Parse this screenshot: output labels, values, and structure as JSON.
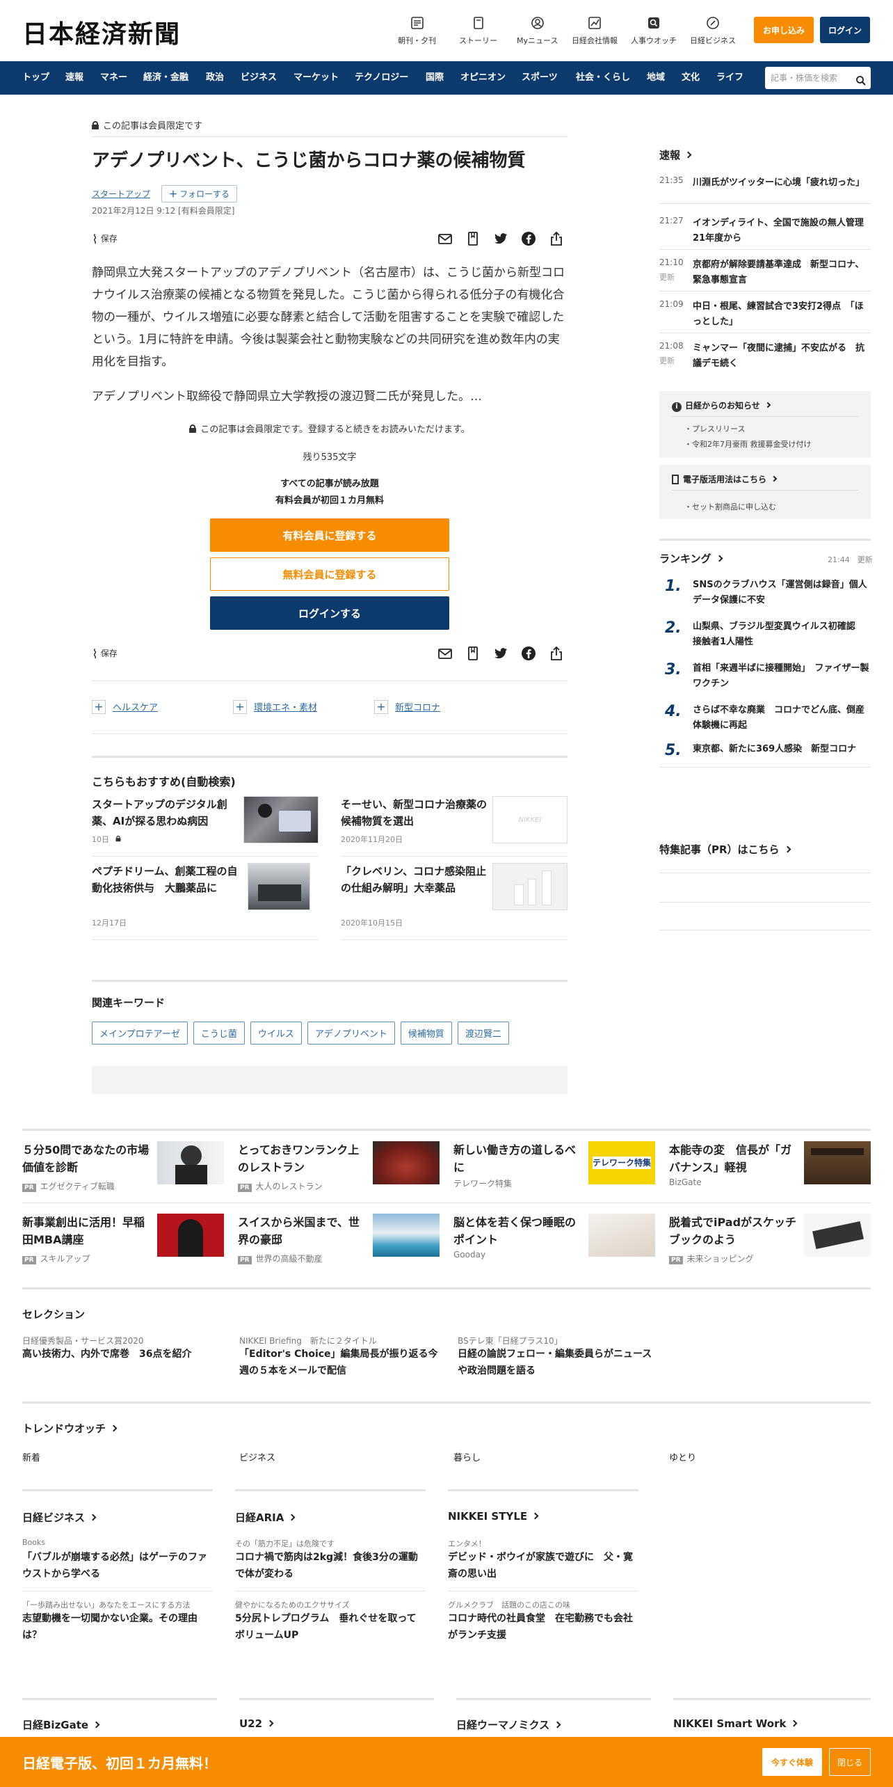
{
  "header": {
    "logo": "日本経済新聞",
    "nav": [
      {
        "label": "朝刊・夕刊",
        "icon": "newspaper-icon"
      },
      {
        "label": "ストーリー",
        "icon": "story-icon"
      },
      {
        "label": "Myニュース",
        "icon": "user-icon"
      },
      {
        "label": "日経会社情報",
        "icon": "chart-icon"
      },
      {
        "label": "人事ウオッチ",
        "icon": "search-icon"
      },
      {
        "label": "日経ビジネス",
        "icon": "compass-icon"
      }
    ],
    "apply": "お申し込み",
    "login": "ログイン"
  },
  "navbar": {
    "items": [
      "トップ",
      "速報",
      "マネー",
      "経済・金融",
      "政治",
      "ビジネス",
      "マーケット",
      "テクノロジー",
      "国際",
      "オピニオン",
      "スポーツ",
      "社会・くらし",
      "地域",
      "文化",
      "ライフ"
    ],
    "search_placeholder": "記事・株価を検索"
  },
  "article": {
    "members_only": "この記事は会員限定です",
    "title": "アデノプリベント、こうじ菌からコロナ薬の候補物質",
    "tag": "スタートアップ",
    "follow": "フォローする",
    "date": "2021年2月12日 9:12 [有料会員限定]",
    "save": "保存",
    "p1": "静岡県立大発スタートアップのアデノプリベント（名古屋市）は、こうじ菌から新型コロナウイルス治療薬の候補となる物質を発見した。こうじ菌から得られる低分子の有機化合物の一種が、ウイルス増殖に必要な酵素と結合して活動を阻害することを実験で確認したという。1月に特許を申請。今後は製薬会社と動物実験などの共同研究を進め数年内の実用化を目指す。",
    "p2": "アデノプリベント取締役で静岡県立大学教授の渡辺賢二氏が発見した。…",
    "paywall_note": "この記事は会員限定です。登録すると続きをお読みいただけます。",
    "remaining": "残り535文字",
    "offer1": "すべての記事が読み放題",
    "offer2": "有料会員が初回１カ月無料",
    "btn_paid": "有料会員に登録する",
    "btn_free": "無料会員に登録する",
    "btn_login": "ログインする",
    "topics": [
      "ヘルスケア",
      "環境エネ・素材",
      "新型コロナ"
    ],
    "rec_title": "こちらもおすすめ(自動検索)",
    "recs": [
      {
        "title": "スタートアップのデジタル創薬、AIが探る思わぬ病因",
        "date": "10日"
      },
      {
        "title": "そーせい、新型コロナ治療薬の候補物質を選出",
        "date": "2020年11月20日"
      },
      {
        "title": "ペプチドリーム、創薬工程の自動化技術供与　大鵬薬品に",
        "date": "12月17日"
      },
      {
        "title": "「クレベリン、コロナ感染阻止の仕組み解明」大幸薬品",
        "date": "2020年10月15日"
      }
    ],
    "nikkei_placeholder": "NIKKEI",
    "kw_title": "関連キーワード",
    "keywords": [
      "メインプロテアーゼ",
      "こうじ菌",
      "ウイルス",
      "アデノプリベント",
      "候補物質",
      "渡辺賢二"
    ]
  },
  "sidebar": {
    "sokuho": "速報",
    "news": [
      {
        "time": "21:35",
        "status": "",
        "title": "川淵氏がツイッターに心境「疲れ切った」"
      },
      {
        "time": "21:27",
        "status": "",
        "title": "イオンディライト、全国で施設の無人管理　21年度から"
      },
      {
        "time": "21:10",
        "status": "更新",
        "title": "京都府が解除要請基準達成　新型コロナ、緊急事態宣言"
      },
      {
        "time": "21:09",
        "status": "",
        "title": "中日・根尾、練習試合で3安打2得点　「ほっとした」"
      },
      {
        "time": "21:08",
        "status": "更新",
        "title": "ミャンマー「夜間に逮捕」不安広がる　抗議デモ続く"
      }
    ],
    "notice_title": "日経からのお知らせ",
    "notice_items": [
      "プレスリリース",
      "令和2年7月豪雨 救援募金受け付け"
    ],
    "guide_title": "電子版活用法はこちら",
    "guide_items": [
      "セット割商品に申し込む"
    ],
    "ranking_title": "ランキング",
    "ranking_time": "21:44",
    "ranking_status": "更新",
    "ranking": [
      {
        "n": "1.",
        "title": "SNSのクラブハウス「運営側は録音」個人データ保護に不安"
      },
      {
        "n": "2.",
        "title": "山梨県、ブラジル型変異ウイルス初確認　接触者1人陽性"
      },
      {
        "n": "3.",
        "title": "首相「来週半ばに接種開始」　ファイザー製ワクチン"
      },
      {
        "n": "4.",
        "title": "さらば不幸な廃業　コロナでどん底、倒産体験機に再起"
      },
      {
        "n": "5.",
        "title": "東京都、新たに369人感染　新型コロナ"
      }
    ],
    "pr_title": "特集記事（PR）はこちら"
  },
  "promos": [
    {
      "title": "５分50問であなたの市場価値を診断",
      "pr": true,
      "source": "エグゼクティブ転職"
    },
    {
      "title": "とっておきワンランク上のレストラン",
      "pr": true,
      "source": "大人のレストラン"
    },
    {
      "title": "新しい働き方の道しるべに",
      "pr": false,
      "source": "テレワーク特集",
      "img_text": "テレワーク特集"
    },
    {
      "title": "本能寺の変　信長が「ガバナンス」軽視",
      "pr": false,
      "source": "BizGate"
    },
    {
      "title": "新事業創出に活用！早稲田MBA講座",
      "pr": true,
      "source": "スキルアップ"
    },
    {
      "title": "スイスから米国まで、世界の豪邸",
      "pr": true,
      "source": "世界の高級不動産"
    },
    {
      "title": "脳と体を若く保つ睡眠のポイント",
      "pr": false,
      "source": "Gooday"
    },
    {
      "title": "脱着式でiPadがスケッチブックのよう",
      "pr": true,
      "source": "未来ショッピング"
    }
  ],
  "selection": {
    "title": "セレクション",
    "items": [
      {
        "kicker": "日経優秀製品・サービス賞2020",
        "title": "高い技術力、内外で席巻　36点を紹介"
      },
      {
        "kicker": "NIKKEI Briefing　新たに２タイトル",
        "title": "「Editor's Choice」編集局長が振り返る今週の５本をメールで配信"
      },
      {
        "kicker": "BSテレ東「日経プラス10」",
        "title": "日経の論説フェロー・編集委員らがニュースや政治問題を語る"
      }
    ]
  },
  "trend": {
    "title": "トレンドウオッチ",
    "tabs": [
      "新着",
      "ビジネス",
      "暮らし",
      "ゆとり"
    ]
  },
  "media": [
    {
      "name": "日経ビジネス",
      "items": [
        {
          "kicker": "Books",
          "title": "「バブルが崩壊する必然」はゲーテのファウストから学べる"
        },
        {
          "kicker": "「一歩踏み出せない」あなたをエースにする方法",
          "title": "志望動機を一切聞かない企業。その理由は？"
        }
      ]
    },
    {
      "name": "日経ARIA",
      "items": [
        {
          "kicker": "その「筋力不足」は危険です",
          "title": "コロナ禍で筋肉は2kg減！食後3分の運動で体が変わる"
        },
        {
          "kicker": "健やかになるためのエクササイズ",
          "title": "5分尻トレプログラム　垂れぐせを取ってボリュームUP"
        }
      ]
    },
    {
      "name": "NIKKEI STYLE",
      "items": [
        {
          "kicker": "エンタメ！",
          "title": "デビッド・ボウイが家族で遊びに　父・寛斎の思い出"
        },
        {
          "kicker": "グルメクラブ　話題のこの店この味",
          "title": "コロナ時代の社員食堂　在宅勤務でも会社がランチ支援"
        }
      ]
    }
  ],
  "bottom_links": [
    "日経BizGate",
    "U22",
    "日経ウーマノミクス",
    "NIKKEI Smart Work"
  ],
  "footer_banner": {
    "text": "日経電子版、初回１カ月無料！",
    "try": "今すぐ体験",
    "close": "閉じる"
  }
}
